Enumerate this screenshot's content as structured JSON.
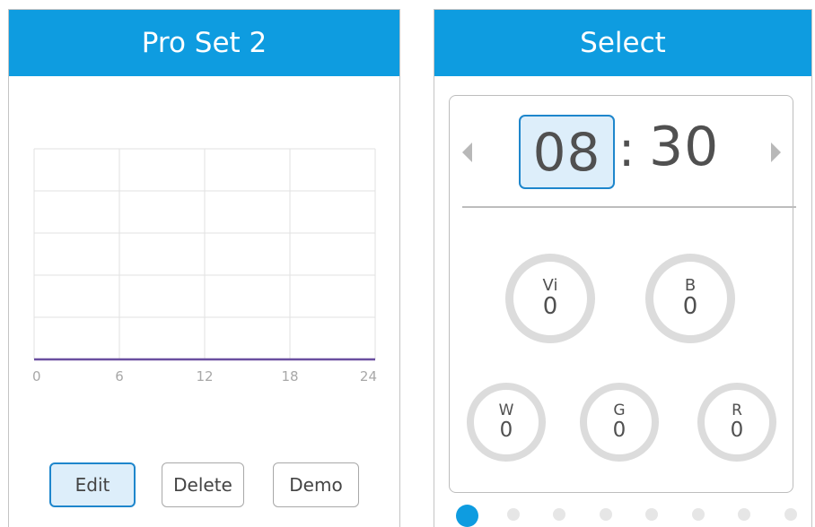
{
  "left_panel": {
    "title": "Pro Set 2",
    "buttons": {
      "edit": "Edit",
      "delete": "Delete",
      "demo": "Demo"
    }
  },
  "right_panel": {
    "title": "Select",
    "time": {
      "hour": "08",
      "separator": ":",
      "minute": "30"
    },
    "channels": [
      {
        "label": "Vi",
        "value": "0"
      },
      {
        "label": "B",
        "value": "0"
      },
      {
        "label": "W",
        "value": "0"
      },
      {
        "label": "G",
        "value": "0"
      },
      {
        "label": "R",
        "value": "0"
      }
    ],
    "pager": {
      "page_count": 8,
      "active_index": 0
    }
  },
  "chart_data": {
    "type": "line",
    "x": [
      0,
      6,
      12,
      18,
      24
    ],
    "x_ticks": [
      "0",
      "6",
      "12",
      "18",
      "24"
    ],
    "xlim": [
      0,
      24
    ],
    "ylim": [
      0,
      5
    ],
    "series": [
      {
        "values": [
          0,
          0,
          0,
          0,
          0
        ],
        "color": "#6a4fa0"
      }
    ],
    "grid": true
  },
  "colors": {
    "header": "#0e9ce0",
    "active_button_fill": "#ddeefa",
    "active_button_border": "#1e86cc",
    "ring": "#dcdcdc",
    "dot_inactive": "#e6e6e6"
  }
}
